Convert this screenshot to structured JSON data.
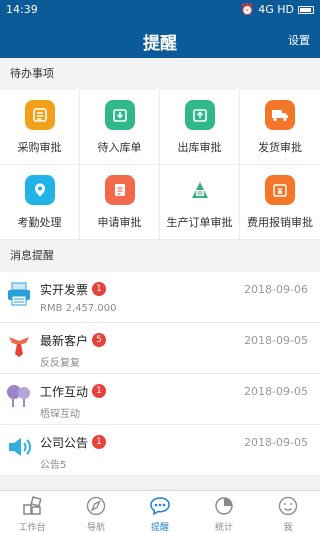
{
  "status_bar": {
    "time": "14:39",
    "network": "4G HD"
  },
  "header": {
    "title": "提醒",
    "settings_label": "设置"
  },
  "todo": {
    "heading": "待办事项",
    "items": [
      {
        "label": "采购审批",
        "icon": "purchase-approval-icon",
        "color": "#f2a21a"
      },
      {
        "label": "待入库单",
        "icon": "inbound-order-icon",
        "color": "#2fb889"
      },
      {
        "label": "出库审批",
        "icon": "outbound-approval-icon",
        "color": "#2fb889"
      },
      {
        "label": "发货审批",
        "icon": "shipping-approval-icon",
        "color": "#f3772b"
      },
      {
        "label": "考勤处理",
        "icon": "attendance-icon",
        "color": "#22b4e6"
      },
      {
        "label": "申请审批",
        "icon": "application-approval-icon",
        "color": "#f26a4b"
      },
      {
        "label": "生产订单审批",
        "icon": "production-order-icon",
        "color": "#3ab07a"
      },
      {
        "label": "费用报销审批",
        "icon": "expense-reimbursement-icon",
        "color": "#f3772b"
      }
    ]
  },
  "messages": {
    "heading": "消息提醒",
    "items": [
      {
        "title": "实开发票",
        "badge": "1",
        "subtitle": "RMB 2,457.000",
        "date": "2018-09-06",
        "icon": "invoice-printer-icon"
      },
      {
        "title": "最新客户",
        "badge": "5",
        "subtitle": "反反复复",
        "date": "2018-09-05",
        "icon": "customer-tie-icon"
      },
      {
        "title": "工作互动",
        "badge": "1",
        "subtitle": "梧琛互动",
        "date": "2018-09-05",
        "icon": "interaction-bubbles-icon"
      },
      {
        "title": "公司公告",
        "badge": "1",
        "subtitle": "公告5",
        "date": "2018-09-05",
        "icon": "announcement-speaker-icon"
      }
    ]
  },
  "tabbar": {
    "items": [
      {
        "label": "工作台",
        "icon": "workbench-icon"
      },
      {
        "label": "导航",
        "icon": "navigation-icon"
      },
      {
        "label": "提醒",
        "icon": "reminder-chat-icon",
        "active": true
      },
      {
        "label": "统计",
        "icon": "statistics-pie-icon"
      },
      {
        "label": "我",
        "icon": "profile-face-icon"
      }
    ]
  },
  "colors": {
    "primary": "#0d5a99",
    "badge": "#e8403a",
    "tab_active": "#1f7fd0"
  }
}
